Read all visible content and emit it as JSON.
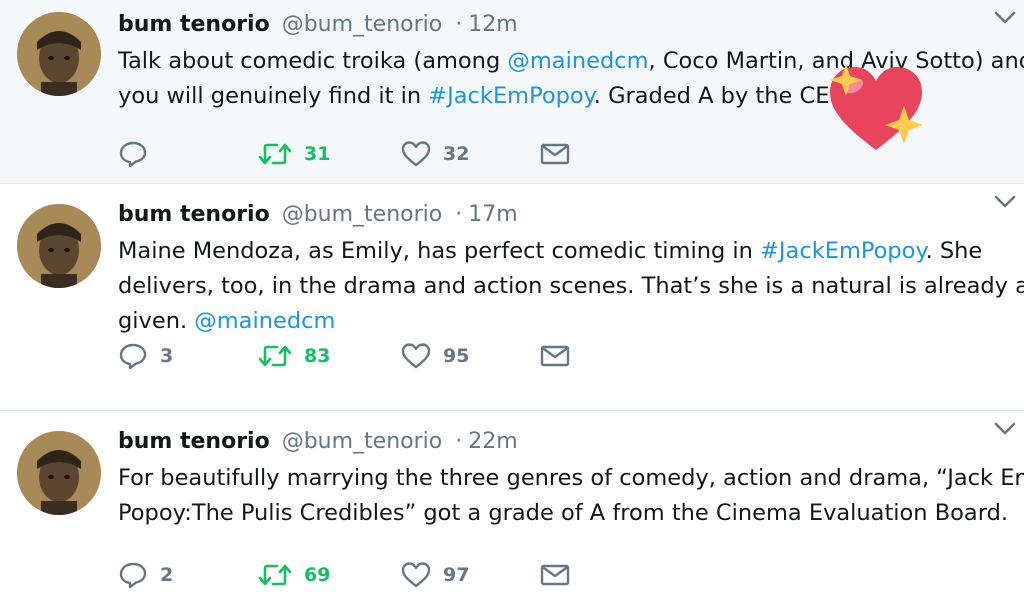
{
  "colors": {
    "link": "#1b95e0",
    "retweet": "#17bf63",
    "muted": "#657786",
    "heart_sticker": "#e8445e"
  },
  "icons": {
    "reply": "reply-icon",
    "retweet": "retweet-icon",
    "like": "heart-outline-icon",
    "dm": "envelope-icon",
    "menu": "chevron-down-icon",
    "sticker": "sparkling-heart-icon"
  },
  "tweets": [
    {
      "name": "bum tenorio",
      "handle": "@bum_tenorio",
      "dot": "·",
      "time": "12m",
      "lines": [
        [
          {
            "t": "Talk about comedic troika (among "
          },
          {
            "t": "@mainedcm",
            "link": true
          },
          {
            "t": ", Coco Martin, and Aviv Sotto) and"
          }
        ],
        [
          {
            "t": "you will genuinely find it in "
          },
          {
            "t": "#JackEmPopoy",
            "link": true
          },
          {
            "t": ". Graded A by the CEB."
          }
        ]
      ],
      "replies": "",
      "retweets": "31",
      "likes": "32"
    },
    {
      "name": "bum tenorio",
      "handle": "@bum_tenorio",
      "dot": "·",
      "time": "17m",
      "lines": [
        [
          {
            "t": "Maine Mendoza, as Emily, has perfect comedic timing in "
          },
          {
            "t": "#JackEmPopoy",
            "link": true
          },
          {
            "t": ". She"
          }
        ],
        [
          {
            "t": "delivers, too, in the drama and action scenes. That’s she is a natural is already a"
          }
        ],
        [
          {
            "t": "given. "
          },
          {
            "t": "@mainedcm",
            "link": true
          }
        ]
      ],
      "replies": "3",
      "retweets": "83",
      "likes": "95"
    },
    {
      "name": "bum tenorio",
      "handle": "@bum_tenorio",
      "dot": "·",
      "time": "22m",
      "lines": [
        [
          {
            "t": "For beautifully marrying the three genres of comedy, action and drama, “Jack Em"
          }
        ],
        [
          {
            "t": "Popoy:The Pulis Credibles” got a grade of A from the Cinema Evaluation Board."
          }
        ]
      ],
      "replies": "2",
      "retweets": "69",
      "likes": "97"
    }
  ]
}
